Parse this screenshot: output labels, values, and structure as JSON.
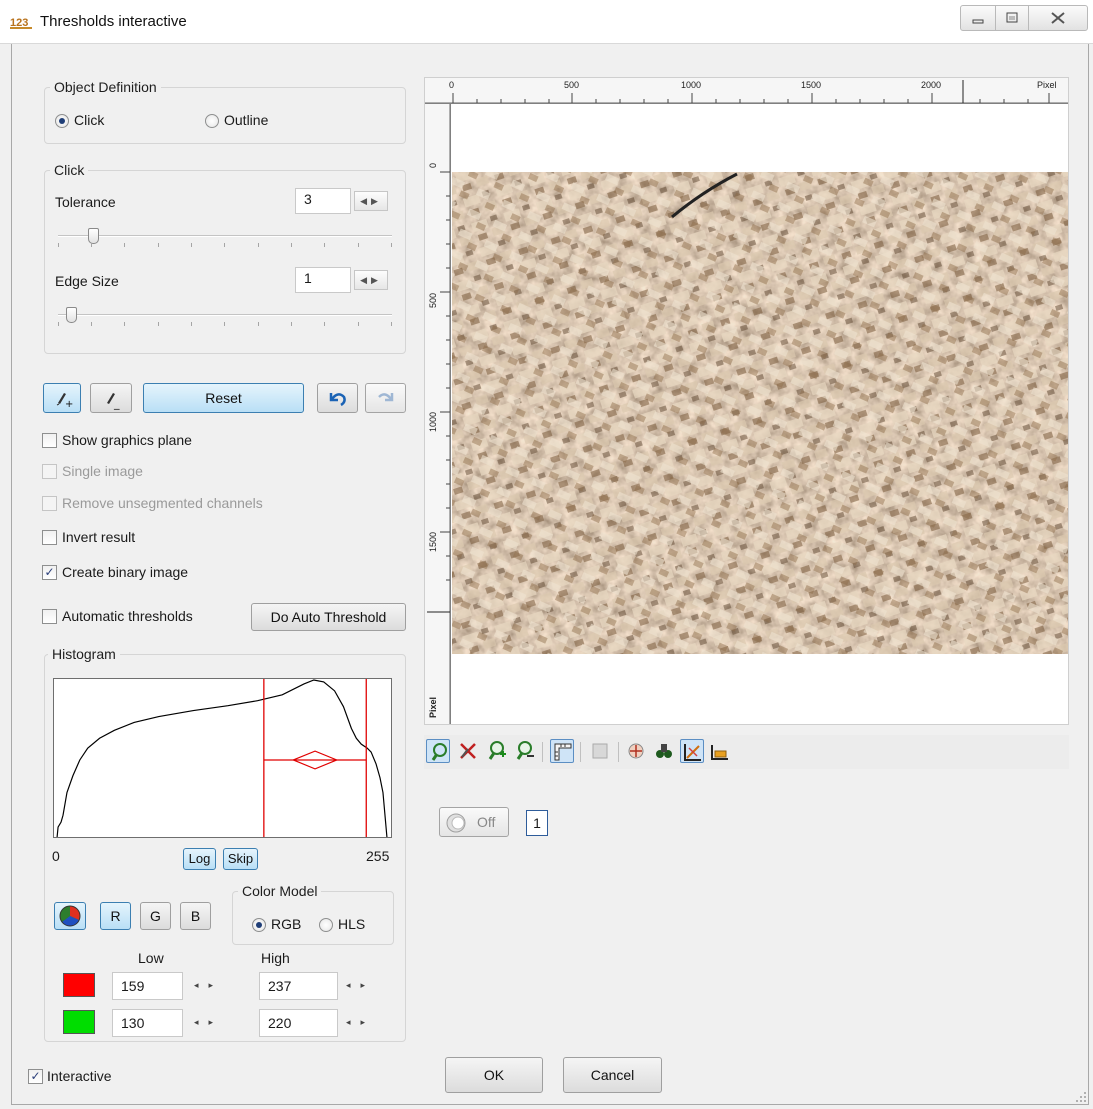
{
  "window": {
    "title": "Thresholds interactive",
    "min_glyph": "▭",
    "max_glyph": "⧉",
    "close_glyph": "✕"
  },
  "object_definition": {
    "title": "Object Definition",
    "options": [
      "Click",
      "Outline"
    ],
    "selected": "Click"
  },
  "click": {
    "title": "Click",
    "tolerance_label": "Tolerance",
    "tolerance_value": "3",
    "tolerance_level": 3,
    "edge_size_label": "Edge Size",
    "edge_size_value": "1",
    "edge_size_level": 1
  },
  "actions": {
    "add_icon": "pencil-plus",
    "remove_icon": "pencil-minus",
    "reset_label": "Reset",
    "undo_icon": "undo",
    "redo_icon": "redo"
  },
  "options": [
    {
      "label": "Show graphics plane",
      "checked": false,
      "enabled": true
    },
    {
      "label": "Single image",
      "checked": false,
      "enabled": false
    },
    {
      "label": "Remove unsegmented channels",
      "checked": false,
      "enabled": false
    },
    {
      "label": "Invert result",
      "checked": false,
      "enabled": true
    },
    {
      "label": "Create binary image",
      "checked": true,
      "enabled": true
    }
  ],
  "auto": {
    "label": "Automatic thresholds",
    "checked": false,
    "button_label": "Do Auto Threshold"
  },
  "histogram": {
    "title": "Histogram",
    "min_label": "0",
    "max_label": "255",
    "log_label": "Log",
    "skip_label": "Skip",
    "low": 159,
    "high": 237,
    "channels": [
      "R",
      "G",
      "B"
    ],
    "selected_channel": "R"
  },
  "color_model": {
    "title": "Color Model",
    "options": [
      "RGB",
      "HLS"
    ],
    "selected": "RGB"
  },
  "thresholds": {
    "low_label": "Low",
    "high_label": "High",
    "rows": [
      {
        "color": "#ff0000",
        "low": "159",
        "high": "237"
      },
      {
        "color": "#00dd00",
        "low": "130",
        "high": "220"
      }
    ]
  },
  "viewer": {
    "x_ticks": [
      "0",
      "500",
      "1000",
      "1500",
      "2000",
      "Pixel"
    ],
    "y_ticks": [
      "0",
      "500",
      "1000",
      "1500",
      "Pixel"
    ],
    "unit": "Pixel"
  },
  "toolbar": {
    "tools": [
      "pan-icon",
      "clear-selection-icon",
      "zoom-in-icon",
      "zoom-out-icon",
      "ruler-icon",
      "overlay-icon",
      "crosshair-icon",
      "binoculars-icon",
      "axes-icon",
      "scale-icon"
    ]
  },
  "live": {
    "toggle_label": "Off",
    "number": "1"
  },
  "footer": {
    "interactive_label": "Interactive",
    "interactive_checked": true,
    "ok_label": "OK",
    "cancel_label": "Cancel"
  }
}
